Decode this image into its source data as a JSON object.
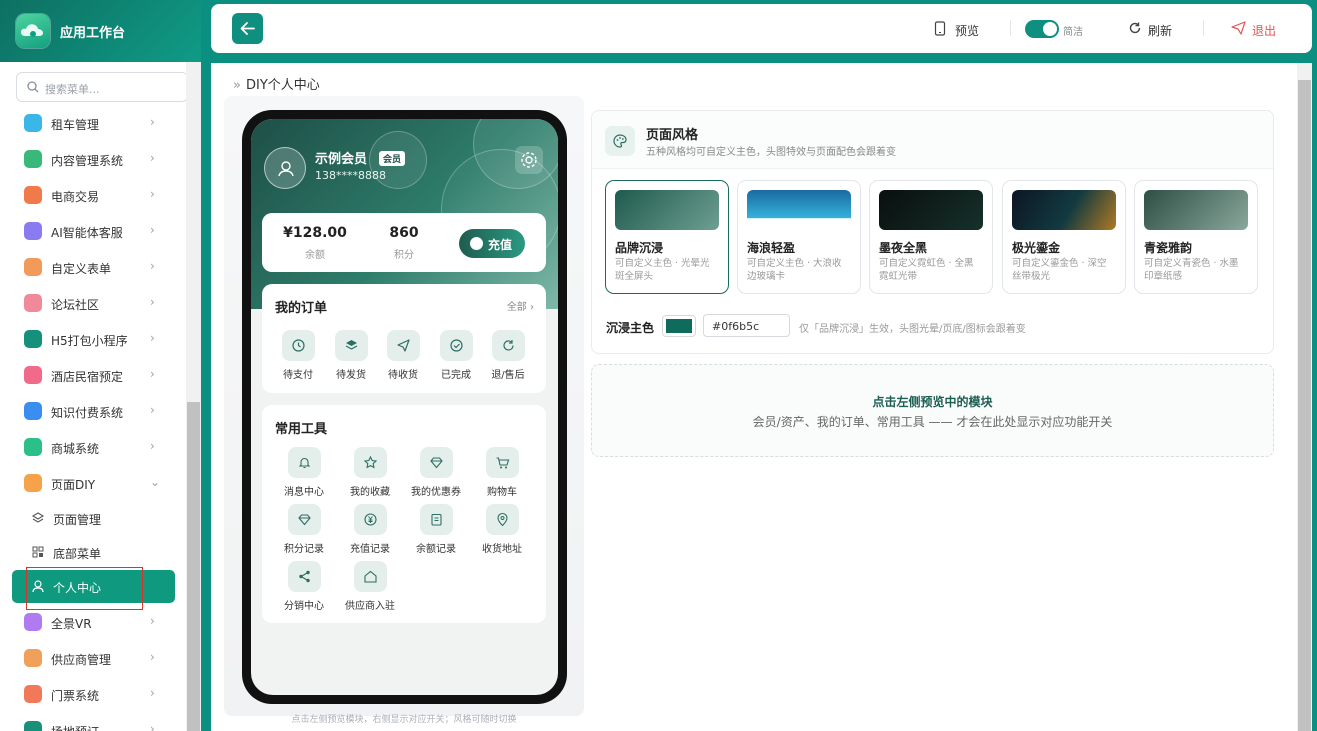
{
  "app": {
    "name": "应用工作台"
  },
  "search": {
    "placeholder": "搜索菜单..."
  },
  "menu": [
    {
      "label": "租车管理",
      "color": "#3ab6e8"
    },
    {
      "label": "内容管理系统",
      "color": "#39b87a"
    },
    {
      "label": "电商交易",
      "color": "#f07a4a"
    },
    {
      "label": "AI智能体客服",
      "color": "#8a7cf0"
    },
    {
      "label": "自定义表单",
      "color": "#f29a5a"
    },
    {
      "label": "论坛社区",
      "color": "#f08a9a"
    },
    {
      "label": "H5打包小程序",
      "color": "#15907a"
    },
    {
      "label": "酒店民宿预定",
      "color": "#f26a8a"
    },
    {
      "label": "知识付费系统",
      "color": "#3a8ef0"
    },
    {
      "label": "商城系统",
      "color": "#2bbf8a"
    },
    {
      "label": "页面DIY",
      "color": "#f5a24a"
    },
    {
      "label": "全景VR",
      "color": "#b07af0"
    },
    {
      "label": "供应商管理",
      "color": "#f0a05a"
    },
    {
      "label": "门票系统",
      "color": "#f2785a"
    },
    {
      "label": "场地预订",
      "color": "#18907a"
    }
  ],
  "submenu": {
    "page_manage": "页面管理",
    "bottom_menu": "底部菜单",
    "personal_center": "个人中心"
  },
  "topbar": {
    "preview": "预览",
    "simple": "简洁",
    "refresh": "刷新",
    "logout": "退出"
  },
  "breadcrumb": "DIY个人中心",
  "phone": {
    "user_name": "示例会员",
    "member_badge": "会员",
    "phone": "138****8888",
    "balance_value": "¥128.00",
    "balance_label": "余额",
    "points_value": "860",
    "points_label": "积分",
    "recharge": "充值",
    "orders_title": "我的订单",
    "orders_more": "全部 ›",
    "orders": [
      "待支付",
      "待发货",
      "待收货",
      "已完成",
      "退/售后"
    ],
    "tools_title": "常用工具",
    "tools": [
      "消息中心",
      "我的收藏",
      "我的优惠券",
      "购物车",
      "积分记录",
      "充值记录",
      "余额记录",
      "收货地址",
      "分销中心",
      "供应商入驻"
    ],
    "hint": "点击左侧预览模块，右侧显示对应开关；风格可随时切换"
  },
  "style_panel": {
    "title": "页面风格",
    "subtitle": "五种风格均可自定义主色，头图特效与页面配色会跟着变",
    "themes": [
      {
        "name": "品牌沉浸",
        "desc": "可自定义主色 · 光晕光斑全屏头"
      },
      {
        "name": "海浪轻盈",
        "desc": "可自定义主色 · 大浪收边玻璃卡"
      },
      {
        "name": "墨夜全黑",
        "desc": "可自定义霓虹色 · 全黑霓虹光带"
      },
      {
        "name": "极光鎏金",
        "desc": "可自定义鎏金色 · 深空丝带极光"
      },
      {
        "name": "青瓷雅韵",
        "desc": "可自定义青瓷色 · 水墨印章纸感"
      }
    ],
    "main_color_label": "沉浸主色",
    "main_color_value": "#0f6b5c",
    "main_color_hint": "仅「品牌沉浸」生效，头图光晕/页底/图标会跟着变"
  },
  "tip": {
    "title": "点击左侧预览中的模块",
    "subtitle": "会员/资产、我的订单、常用工具 —— 才会在此处显示对应功能开关"
  }
}
